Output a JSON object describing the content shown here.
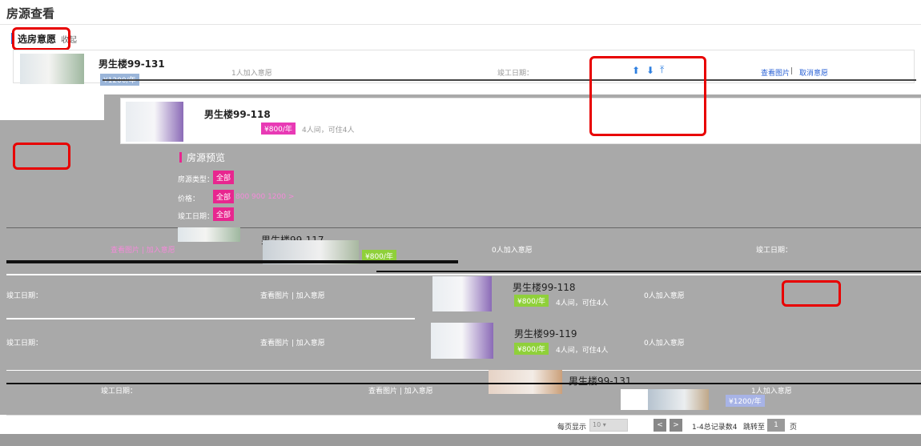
{
  "page": {
    "title": "房源查看"
  },
  "tabs": [
    {
      "label": "选房意愿"
    },
    {
      "label": "收起"
    }
  ],
  "first_card": {
    "name": "男生楼99-131",
    "price_label": "¥1200/年",
    "count_text": "1人加入意愿",
    "date_label": "竣工日期：",
    "links": {
      "view": "查看图片",
      "separator": " | ",
      "cancel": "取消意愿"
    }
  },
  "second_card": {
    "name": "男生楼99-118",
    "price_label": "¥800/年",
    "meta_text": "4人间，可住4人"
  },
  "filters": {
    "title": "房源预览",
    "rows": [
      {
        "label": "房源类型：",
        "tag": "全部"
      },
      {
        "label": "价格：",
        "tag": "全部",
        "options": "800  900  1200  >"
      },
      {
        "label": "竣工日期：",
        "tag": "全部"
      }
    ]
  },
  "list": [
    {
      "name": "男生楼99-117",
      "count_text": "0人加入意愿",
      "date_label": "竣工日期：",
      "links": "查看图片 | 加入意愿"
    },
    {
      "name": "男生楼99-118",
      "price_label": "¥800/年",
      "meta_text": "4人间，可住4人",
      "count_text": "0人加入意愿",
      "date_label": "竣工日期：",
      "links": "查看图片 | 加入意愿"
    },
    {
      "name": "男生楼99-119",
      "price_label": "¥800/年",
      "meta_text": "4人间，可住4人",
      "count_text": "0人加入意愿",
      "date_label": "竣工日期：",
      "links": "查看图片 | 加入意愿"
    },
    {
      "name": "男生楼99-131",
      "price_label": "¥1200/年",
      "count_text": "1人加入意愿",
      "date_label": "竣工日期：",
      "links": "查看图片 | 加入意愿"
    }
  ],
  "footer": {
    "per_page_label": "每页显示",
    "per_page_value": "10",
    "prev_icon": "<",
    "next_icon": ">",
    "records_text": "1-4总记录数4",
    "goto_label": "跳转至",
    "goto_value": "1",
    "page_suffix": "页"
  },
  "icons": {
    "move_up": "arrow-up-icon",
    "move_down": "arrow-down-icon",
    "move_top": "arrow-top-icon"
  },
  "colors": {
    "accent": "#e8268f",
    "link": "#2a62d6",
    "annotation": "#e80000"
  }
}
